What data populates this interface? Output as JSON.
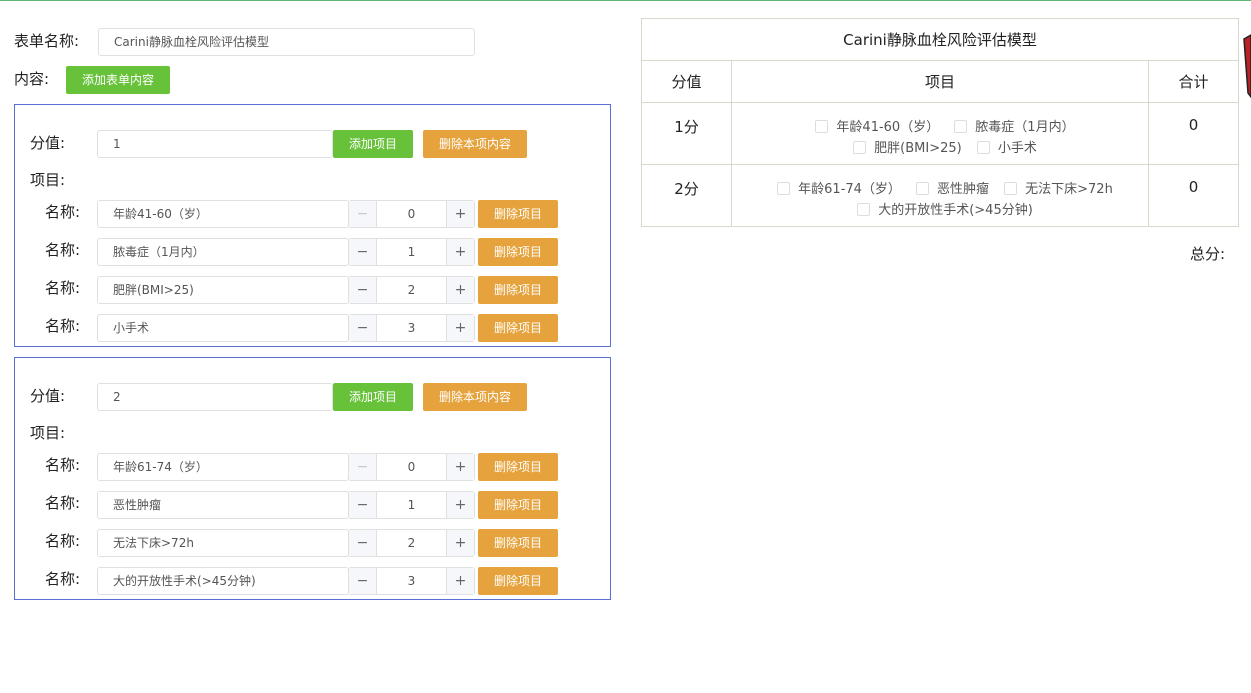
{
  "form": {
    "name_label": "表单名称:",
    "name_value": "Carini静脉血栓风险评估模型",
    "content_label": "内容:",
    "add_content_label": "添加表单内容"
  },
  "labels": {
    "score": "分值:",
    "items": "项目:",
    "name": "名称:",
    "add_item": "添加项目",
    "delete_section": "删除本项内容",
    "delete_item": "删除项目",
    "dec": "−",
    "inc": "+"
  },
  "sections": [
    {
      "score": "1",
      "items": [
        {
          "name": "年龄41-60（岁）",
          "order": "0"
        },
        {
          "name": "脓毒症（1月内）",
          "order": "1"
        },
        {
          "name": "肥胖(BMI>25)",
          "order": "2"
        },
        {
          "name": "小手术",
          "order": "3"
        }
      ]
    },
    {
      "score": "2",
      "items": [
        {
          "name": "年龄61-74（岁）",
          "order": "0"
        },
        {
          "name": "恶性肿瘤",
          "order": "1"
        },
        {
          "name": "无法下床>72h",
          "order": "2"
        },
        {
          "name": "大的开放性手术(>45分钟)",
          "order": "3"
        }
      ]
    }
  ],
  "preview": {
    "title": "Carini静脉血栓风险评估模型",
    "headers": [
      "分值",
      "项目",
      "合计"
    ],
    "rows": [
      {
        "score": "1分",
        "options": [
          "年龄41-60（岁）",
          "脓毒症（1月内）",
          "肥胖(BMI>25)",
          "小手术"
        ],
        "total": "0"
      },
      {
        "score": "2分",
        "options": [
          "年龄61-74（岁）",
          "恶性肿瘤",
          "无法下床>72h",
          "大的开放性手术(>45分钟)"
        ],
        "total": "0"
      }
    ],
    "total_label": "总分:"
  }
}
